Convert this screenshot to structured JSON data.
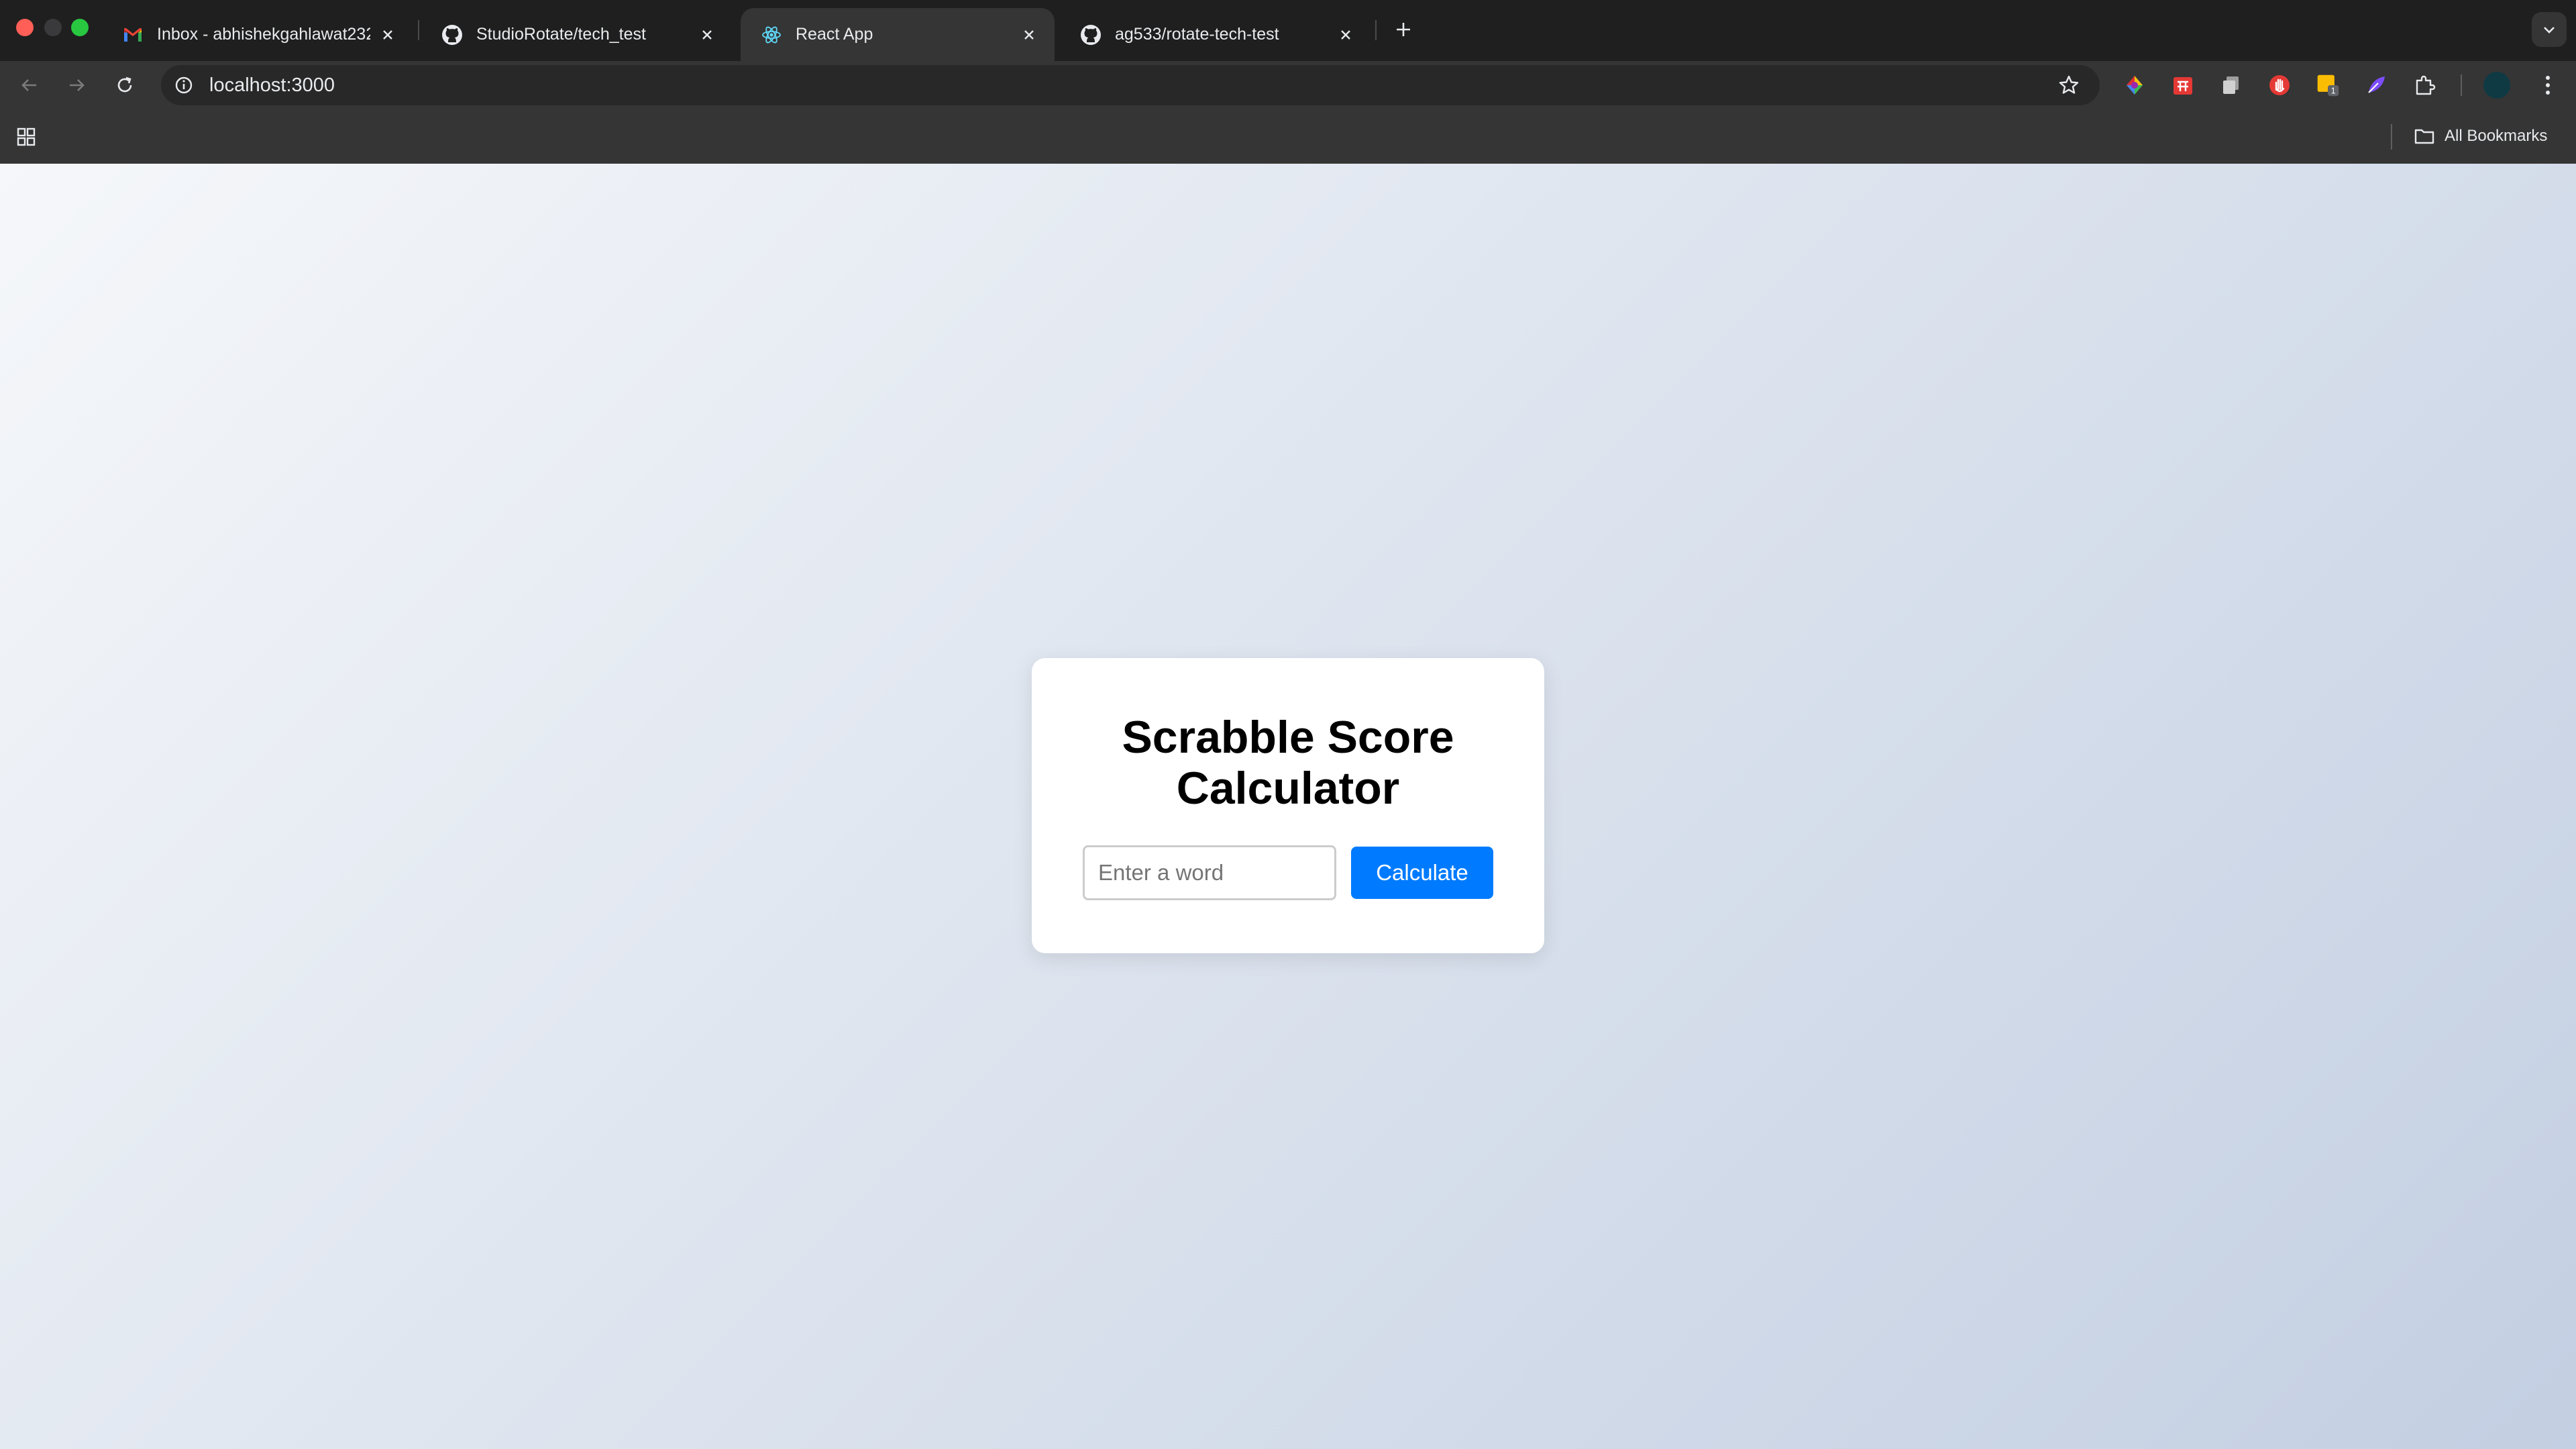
{
  "browser": {
    "tabs": [
      {
        "title": "Inbox - abhishekgahlawat232",
        "icon": "gmail-icon",
        "active": false
      },
      {
        "title": "StudioRotate/tech_test",
        "icon": "github-icon",
        "active": false
      },
      {
        "title": "React App",
        "icon": "react-icon",
        "active": true
      },
      {
        "title": "ag533/rotate-tech-test",
        "icon": "github-icon",
        "active": false
      }
    ],
    "address_bar": {
      "url": "localhost:3000"
    },
    "extensions": [
      "color-wheel-icon",
      "puzzle-red-icon",
      "copy-icon",
      "hand-stop-icon",
      "sticky-note-icon",
      "feather-icon",
      "extensions-puzzle-icon"
    ],
    "extension_badge": "1",
    "bookmarks_bar": {
      "all_bookmarks_label": "All Bookmarks"
    },
    "colors": {
      "frame": "#1f1f1f",
      "toolbar": "#353535",
      "omnibox": "#282828"
    }
  },
  "app": {
    "title": "Scrabble Score Calculator",
    "input": {
      "placeholder": "Enter a word",
      "value": ""
    },
    "button_label": "Calculate",
    "colors": {
      "button": "#007bff",
      "card": "#ffffff",
      "background_start": "#f5f7fa",
      "background_end": "#c3cfe2"
    }
  }
}
